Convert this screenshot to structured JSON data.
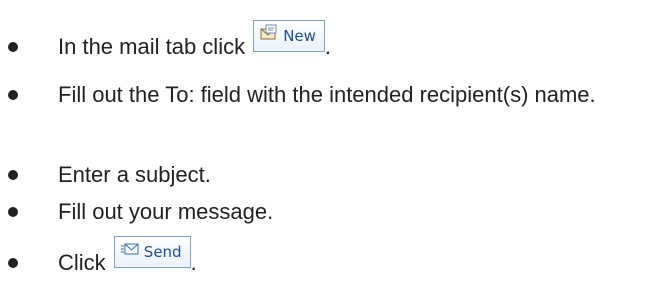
{
  "steps": [
    {
      "text": "In the mail tab click",
      "button_label": "New",
      "button_icon": "new-mail-icon",
      "suffix": "."
    },
    {
      "text": "Fill out the To: field with the intended recipient(s) name."
    },
    {
      "text": "Enter a subject."
    },
    {
      "text": "Fill out your message."
    },
    {
      "text": "Click",
      "button_label": "Send",
      "button_icon": "send-mail-icon",
      "suffix": "."
    }
  ]
}
